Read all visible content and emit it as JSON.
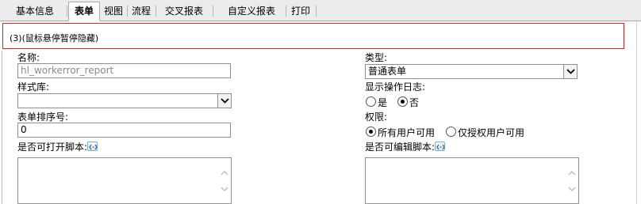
{
  "tabs": [
    {
      "label": "基本信息",
      "active": false
    },
    {
      "label": "表单",
      "active": true
    },
    {
      "label": "视图",
      "active": false
    },
    {
      "label": "流程",
      "active": false
    },
    {
      "label": "交叉报表",
      "active": false
    },
    {
      "label": "自定义报表",
      "active": false
    },
    {
      "label": "打印",
      "active": false
    }
  ],
  "hint": "(3)(鼠标悬停暂停隐藏)",
  "form": {
    "name_label": "名称:",
    "name_value": "hl_workerror_report",
    "style_label": "样式库:",
    "style_value": "",
    "order_label": "表单排序号:",
    "order_value": "0",
    "open_script_label": "是否可打开脚本:",
    "type_label": "类型:",
    "type_value": "普通表单",
    "log_label": "显示操作日志:",
    "log_yes": "是",
    "log_no": "否",
    "log_selected": "否",
    "perm_label": "权限:",
    "perm_all": "所有用户可用",
    "perm_auth": "仅授权用户可用",
    "perm_selected": "所有用户可用",
    "edit_script_label": "是否可编辑脚本:"
  },
  "icons": {
    "select_arrow": "chevron-down-icon",
    "script": "script-icon",
    "scroll_up": "scroll-up-icon",
    "scroll_down": "scroll-down-icon"
  }
}
